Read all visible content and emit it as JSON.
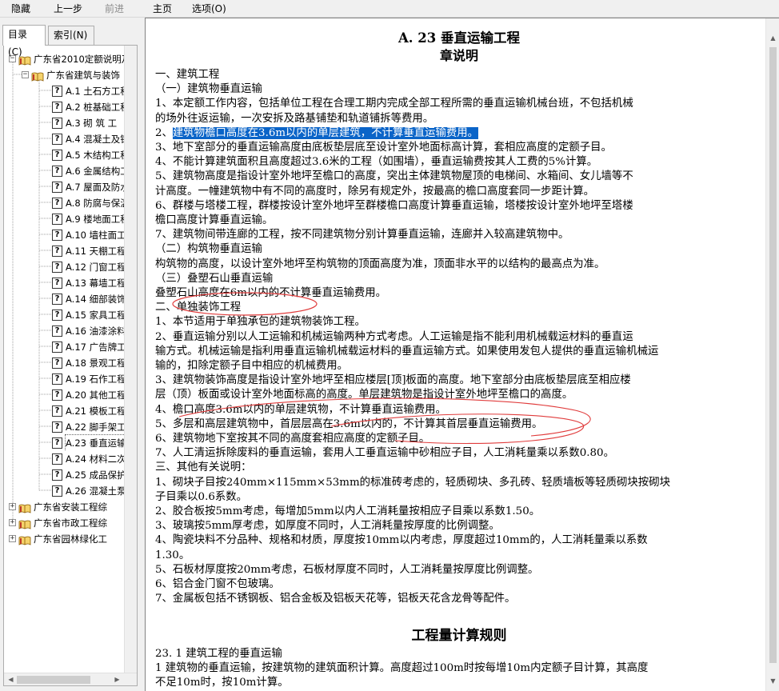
{
  "toolbar": {
    "hide": "隐藏",
    "back": "上一步",
    "forward": "前进",
    "home": "主页",
    "options": "选项(O)"
  },
  "tabs": {
    "contents": "目录(C)",
    "index": "索引(N)"
  },
  "tree": {
    "root": "广东省2010定额说明及",
    "building": "广东省建筑与装饰",
    "items": [
      {
        "id": "A.1",
        "label": "土石方工程"
      },
      {
        "id": "A.2",
        "label": "桩基础工程"
      },
      {
        "id": "A.3",
        "label": "砌  筑  工"
      },
      {
        "id": "A.4",
        "label": "混凝土及钢"
      },
      {
        "id": "A.5",
        "label": "木结构工程"
      },
      {
        "id": "A.6",
        "label": "金属结构工"
      },
      {
        "id": "A.7",
        "label": "屋面及防水"
      },
      {
        "id": "A.8",
        "label": "防腐与保温"
      },
      {
        "id": "A.9",
        "label": "楼地面工程"
      },
      {
        "id": "A.10",
        "label": "墙柱面工"
      },
      {
        "id": "A.11",
        "label": "天棚工程"
      },
      {
        "id": "A.12",
        "label": "门窗工程"
      },
      {
        "id": "A.13",
        "label": "幕墙工程"
      },
      {
        "id": "A.14",
        "label": "细部装饰"
      },
      {
        "id": "A.15",
        "label": "家具工程"
      },
      {
        "id": "A.16",
        "label": "油漆涂料"
      },
      {
        "id": "A.17",
        "label": "广告牌工"
      },
      {
        "id": "A.18",
        "label": "景观工程"
      },
      {
        "id": "A.19",
        "label": "石作工程"
      },
      {
        "id": "A.20",
        "label": "其他工程"
      },
      {
        "id": "A.21",
        "label": "模板工程"
      },
      {
        "id": "A.22",
        "label": "脚手架工"
      },
      {
        "id": "A.23",
        "label": "垂直运输"
      },
      {
        "id": "A.24",
        "label": "材料二次"
      },
      {
        "id": "A.25",
        "label": "成品保护"
      },
      {
        "id": "A.26",
        "label": "混凝土泵"
      }
    ],
    "other_books": [
      "广东省安装工程综",
      "广东省市政工程综",
      "广东省园林绿化工"
    ]
  },
  "doc": {
    "title": "A. 23   垂直运输工程",
    "subtitle": "章说明",
    "lines": [
      "    一、建筑工程",
      "    （一）建筑物垂直运输",
      "    1、本定额工作内容，包括单位工程在合理工期内完成全部工程所需的垂直运输机械台班，不包括机械",
      "的场外往返运输，一次安拆及路基铺垫和轨道铺拆等费用。",
      "    2、建筑物檐口高度在3.6m以内的单层建筑，不计算垂直运输费用。",
      "    3、地下室部分的垂直运输高度由底板垫层底至设计室外地面标高计算，套相应高度的定额子目。",
      "    4、不能计算建筑面积且高度超过3.6米的工程（如围墙），垂直运输费按其人工费的5%计算。",
      "    5、建筑物高度是指设计室外地坪至檐口的高度，突出主体建筑物屋顶的电梯间、水箱间、女儿墙等不",
      "计高度。一幢建筑物中有不同的高度时，除另有规定外，按最高的檐口高度套同一步距计算。",
      "    6、群楼与塔楼工程，群楼按设计室外地坪至群楼檐口高度计算垂直运输，塔楼按设计室外地坪至塔楼",
      "檐口高度计算垂直运输。",
      "    7、建筑物间带连廊的工程，按不同建筑物分别计算垂直运输，连廊并入较高建筑物中。",
      "    （二）构筑物垂直运输",
      "    构筑物的高度，以设计室外地坪至构筑物的顶面高度为准，顶面非水平的以结构的最高点为准。",
      "    （三）叠塑石山垂直运输",
      "    叠塑石山高度在6m以内的不计算垂直运输费用。",
      "    二、单独装饰工程",
      "    1、本节适用于单独承包的建筑物装饰工程。",
      "    2、垂直运输分别以人工运输和机械运输两种方式考虑。人工运输是指不能利用机械载运材料的垂直运",
      "输方式。机械运输是指利用垂直运输机械载运材料的垂直运输方式。如果使用发包人提供的垂直运输机械运",
      "输的，扣除定额子目中相应的机械费用。",
      "    3、建筑物装饰高度是指设计室外地坪至相应楼层[顶]板面的高度。地下室部分由底板垫层底至相应楼",
      "层（顶）板面或设计室外地面标高的高度。单层建筑物是指设计室外地坪至檐口的高度。",
      "    4、檐口高度3.6m以内的单层建筑物，不计算垂直运输费用。",
      "    5、多层和高层建筑物中，首层层高在3.6m以内的，不计算其首层垂直运输费用。",
      "    6、建筑物地下室按其不同的高度套相应高度的定额子目。",
      "    7、人工清运拆除废料的垂直运输，套用人工垂直运输中砂相应子目，人工消耗量乘以系数0.80。",
      "    三、其他有关说明：",
      "    1、砌块子目按240mm×115mm×53mm的标准砖考虑的，轻质砌块、多孔砖、轻质墙板等轻质砌块按砌块",
      "子目乘以0.6系数。",
      "    2、胶合板按5mm考虑，每增加5mm以内人工消耗量按相应子目乘以系数1.50。",
      "    3、玻璃按5mm厚考虑，如厚度不同时，人工消耗量按厚度的比例调整。",
      "    4、陶瓷块料不分品种、规格和材质，厚度按10mm以内考虑，厚度超过10mm的，人工消耗量乘以系数",
      "1.30。",
      "    5、石板材厚度按20mm考虑，石板材厚度不同时，人工消耗量按厚度比例调整。",
      "    6、铝合金门窗不包玻璃。",
      "    7、金属板包括不锈钢板、铝合金板及铝板天花等，铝板天花含龙骨等配件。"
    ],
    "section2_title": "工程量计算规则",
    "section2_lines": [
      "23. 1  建筑工程的垂直运输",
      "    1  建筑物的垂直运输，按建筑物的建筑面积计算。高度超过100m时按每增10m内定额子目计算，其高度",
      "不足10m时，按10m计算。"
    ]
  },
  "colors": {
    "highlight": "#0a64c8",
    "annotation": "#e03c3c",
    "text": "#000000",
    "disabled": "#8c8c8c"
  }
}
